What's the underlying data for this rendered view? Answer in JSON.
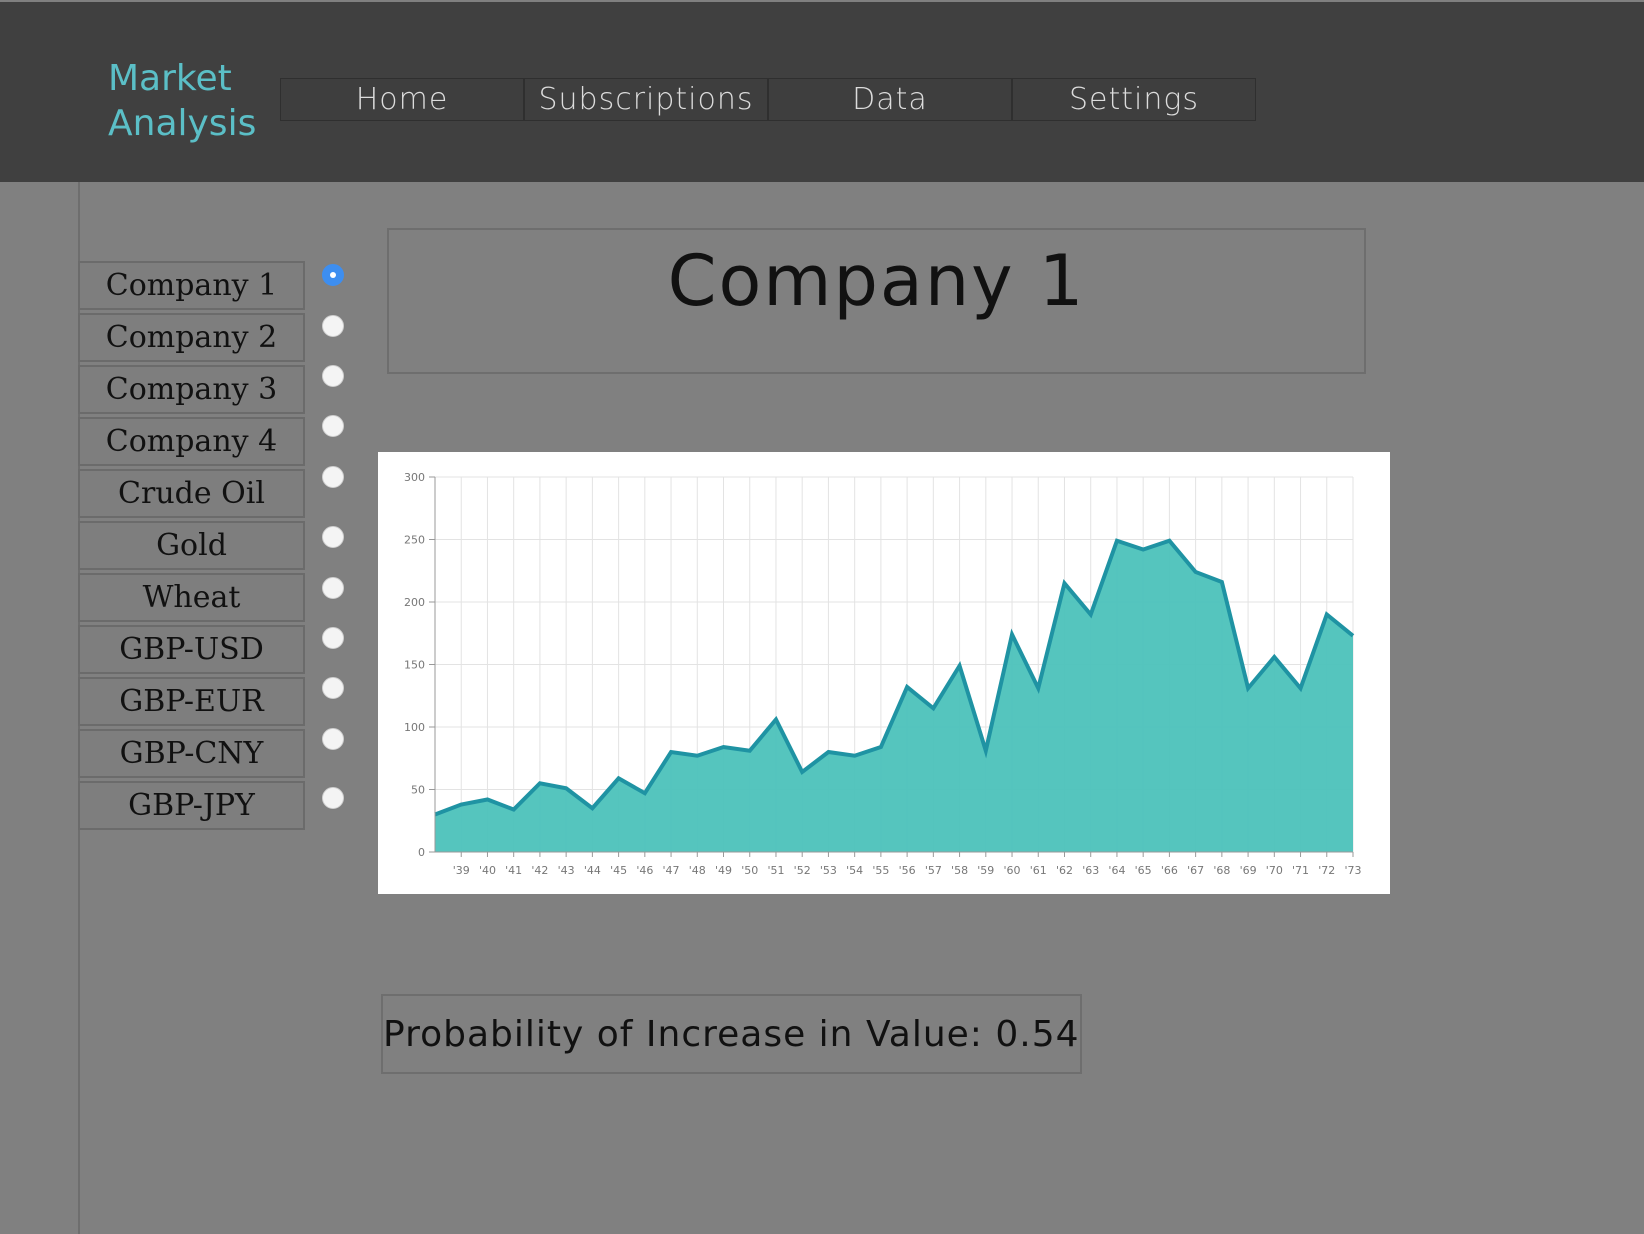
{
  "app": {
    "title_line1": "Market",
    "title_line2": "Analysis"
  },
  "nav": {
    "tabs": [
      "Home",
      "Subscriptions",
      "Data",
      "Settings"
    ]
  },
  "sidebar": {
    "items": [
      {
        "label": "Company 1",
        "selected": true
      },
      {
        "label": "Company 2",
        "selected": false
      },
      {
        "label": "Company 3",
        "selected": false
      },
      {
        "label": "Company 4",
        "selected": false
      },
      {
        "label": "Crude Oil",
        "selected": false
      },
      {
        "label": "Gold",
        "selected": false
      },
      {
        "label": "Wheat",
        "selected": false
      },
      {
        "label": "GBP-USD",
        "selected": false
      },
      {
        "label": "GBP-EUR",
        "selected": false
      },
      {
        "label": "GBP-CNY",
        "selected": false
      },
      {
        "label": "GBP-JPY",
        "selected": false
      }
    ]
  },
  "main": {
    "title": "Company 1",
    "probability_text": "Probability of Increase in Value: 0.54"
  },
  "colors": {
    "accent": "#5bbfc7",
    "header_bg": "#404040",
    "page_bg": "#808080",
    "area_fill": "#4cc2bb",
    "area_stroke": "#1f93a3",
    "radio_selected": "#3d8ef0"
  },
  "chart_data": {
    "type": "area",
    "title": "",
    "xlabel": "",
    "ylabel": "",
    "ylim": [
      0,
      300
    ],
    "yticks": [
      0,
      50,
      100,
      150,
      200,
      250,
      300
    ],
    "grid": true,
    "categories": [
      "'39",
      "'40",
      "'41",
      "'42",
      "'43",
      "'44",
      "'45",
      "'46",
      "'47",
      "'48",
      "'49",
      "'50",
      "'51",
      "'52",
      "'53",
      "'54",
      "'55",
      "'56",
      "'57",
      "'58",
      "'59",
      "'60",
      "'61",
      "'62",
      "'63",
      "'64",
      "'65",
      "'66",
      "'67",
      "'68",
      "'69",
      "'70",
      "'71",
      "'72",
      "'73"
    ],
    "series": [
      {
        "values": [
          30,
          38,
          42,
          34,
          55,
          51,
          35,
          59,
          47,
          80,
          77,
          84,
          81,
          106,
          64,
          80,
          77,
          84,
          132,
          115,
          149,
          81,
          174,
          131,
          215,
          190,
          249,
          242,
          249,
          224,
          216,
          131,
          156,
          131,
          190,
          173
        ]
      }
    ]
  }
}
